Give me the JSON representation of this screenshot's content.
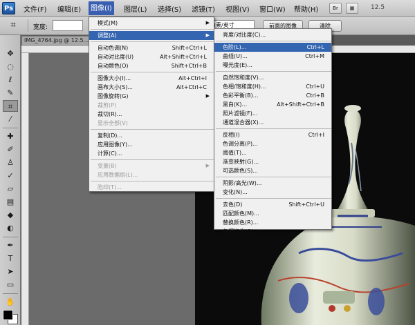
{
  "menubar": {
    "logo": "Ps",
    "items": [
      "文件(F)",
      "编辑(E)",
      "图像(I)",
      "图层(L)",
      "选择(S)",
      "滤镜(T)",
      "视图(V)",
      "窗口(W)",
      "帮助(H)"
    ],
    "zoom": "12.5"
  },
  "options": {
    "width_label": "宽度:",
    "dropdown_value": "像素/英寸",
    "front_image_button": "前面的图像",
    "clear_button": "清除"
  },
  "document": {
    "tab_title": "IMG_4764.jpg @ 12.5..."
  },
  "image_menu": [
    {
      "label": "模式(M)",
      "shortcut": "",
      "submenu": true,
      "disabled": false,
      "highlight": false
    },
    {
      "sep": true
    },
    {
      "label": "调整(A)",
      "shortcut": "",
      "submenu": true,
      "disabled": false,
      "highlight": true
    },
    {
      "sep": true
    },
    {
      "label": "自动色调(N)",
      "shortcut": "Shift+Ctrl+L",
      "submenu": false,
      "disabled": false,
      "highlight": false
    },
    {
      "label": "自动对比度(U)",
      "shortcut": "Alt+Shift+Ctrl+L",
      "submenu": false,
      "disabled": false,
      "highlight": false
    },
    {
      "label": "自动颜色(O)",
      "shortcut": "Shift+Ctrl+B",
      "submenu": false,
      "disabled": false,
      "highlight": false
    },
    {
      "sep": true
    },
    {
      "label": "图像大小(I)...",
      "shortcut": "Alt+Ctrl+I",
      "submenu": false,
      "disabled": false,
      "highlight": false
    },
    {
      "label": "画布大小(S)...",
      "shortcut": "Alt+Ctrl+C",
      "submenu": false,
      "disabled": false,
      "highlight": false
    },
    {
      "label": "图像旋转(G)",
      "shortcut": "",
      "submenu": true,
      "disabled": false,
      "highlight": false
    },
    {
      "label": "裁剪(P)",
      "shortcut": "",
      "submenu": false,
      "disabled": true,
      "highlight": false
    },
    {
      "label": "裁切(R)...",
      "shortcut": "",
      "submenu": false,
      "disabled": false,
      "highlight": false
    },
    {
      "label": "显示全部(V)",
      "shortcut": "",
      "submenu": false,
      "disabled": true,
      "highlight": false
    },
    {
      "sep": true
    },
    {
      "label": "复制(D)...",
      "shortcut": "",
      "submenu": false,
      "disabled": false,
      "highlight": false
    },
    {
      "label": "应用图像(Y)...",
      "shortcut": "",
      "submenu": false,
      "disabled": false,
      "highlight": false
    },
    {
      "label": "计算(C)...",
      "shortcut": "",
      "submenu": false,
      "disabled": false,
      "highlight": false
    },
    {
      "sep": true
    },
    {
      "label": "变量(B)",
      "shortcut": "",
      "submenu": true,
      "disabled": true,
      "highlight": false
    },
    {
      "label": "应用数据组(L)...",
      "shortcut": "",
      "submenu": false,
      "disabled": true,
      "highlight": false
    },
    {
      "sep": true
    },
    {
      "label": "陷印(T)...",
      "shortcut": "",
      "submenu": false,
      "disabled": true,
      "highlight": false
    }
  ],
  "adjust_menu": [
    {
      "label": "亮度/对比度(C)...",
      "shortcut": "",
      "highlight": false
    },
    {
      "sep": true
    },
    {
      "label": "色阶(L)...",
      "shortcut": "Ctrl+L",
      "highlight": true
    },
    {
      "label": "曲线(U)...",
      "shortcut": "Ctrl+M",
      "highlight": false
    },
    {
      "label": "曝光度(E)...",
      "shortcut": "",
      "highlight": false
    },
    {
      "sep": true
    },
    {
      "label": "自然饱和度(V)...",
      "shortcut": "",
      "highlight": false
    },
    {
      "label": "色相/饱和度(H)...",
      "shortcut": "Ctrl+U",
      "highlight": false
    },
    {
      "label": "色彩平衡(B)...",
      "shortcut": "Ctrl+B",
      "highlight": false
    },
    {
      "label": "黑白(K)...",
      "shortcut": "Alt+Shift+Ctrl+B",
      "highlight": false
    },
    {
      "label": "照片滤镜(F)...",
      "shortcut": "",
      "highlight": false
    },
    {
      "label": "通道混合器(X)...",
      "shortcut": "",
      "highlight": false
    },
    {
      "sep": true
    },
    {
      "label": "反相(I)",
      "shortcut": "Ctrl+I",
      "highlight": false
    },
    {
      "label": "色调分离(P)...",
      "shortcut": "",
      "highlight": false
    },
    {
      "label": "阈值(T)...",
      "shortcut": "",
      "highlight": false
    },
    {
      "label": "渐变映射(G)...",
      "shortcut": "",
      "highlight": false
    },
    {
      "label": "可选颜色(S)...",
      "shortcut": "",
      "highlight": false
    },
    {
      "sep": true
    },
    {
      "label": "阴影/高光(W)...",
      "shortcut": "",
      "highlight": false
    },
    {
      "label": "变化(N)...",
      "shortcut": "",
      "highlight": false
    },
    {
      "sep": true
    },
    {
      "label": "去色(D)",
      "shortcut": "Shift+Ctrl+U",
      "highlight": false
    },
    {
      "label": "匹配颜色(M)...",
      "shortcut": "",
      "highlight": false
    },
    {
      "label": "替换颜色(R)...",
      "shortcut": "",
      "highlight": false
    },
    {
      "label": "色调均化(Q)",
      "shortcut": "",
      "highlight": false
    }
  ],
  "colors": {
    "highlight": "#3465b0",
    "menu_bg": "#f0f0f0",
    "canvas_bg": "#0b0b0b"
  }
}
